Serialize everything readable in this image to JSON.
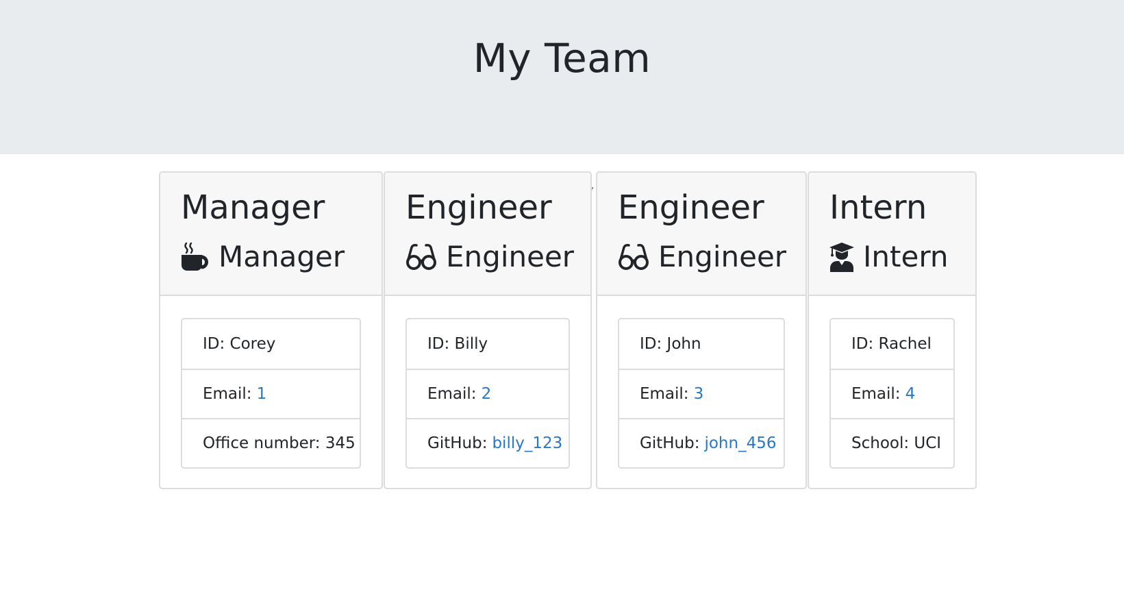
{
  "page": {
    "title": "My Team"
  },
  "colors": {
    "header_bg": "#e9ecef",
    "card_header_bg": "#f7f7f7",
    "link": "#2878c8",
    "text": "#212529"
  },
  "employees": [
    {
      "title": "Manager",
      "role": "Manager",
      "icon": "coffee-icon",
      "id_label": "ID: Corey",
      "email_label": "Email:",
      "email_value": "1",
      "extra_label": "Office number: 345",
      "extra_value": ""
    },
    {
      "title": "Engineer",
      "role": "Engineer",
      "icon": "glasses-icon",
      "id_label": "ID: Billy",
      "email_label": "Email:",
      "email_value": "2",
      "extra_label": "GitHub:",
      "extra_value": "billy_123"
    },
    {
      "title": "Engineer",
      "role": "Engineer",
      "icon": "glasses-icon",
      "id_label": "ID: John",
      "email_label": "Email:",
      "email_value": "3",
      "extra_label": "GitHub:",
      "extra_value": "john_456"
    },
    {
      "title": "Intern",
      "role": "Intern",
      "icon": "graduate-icon",
      "id_label": "ID: Rachel",
      "email_label": "Email:",
      "email_value": "4",
      "extra_label": "School: UCI",
      "extra_value": ""
    }
  ],
  "stray_mark": ","
}
